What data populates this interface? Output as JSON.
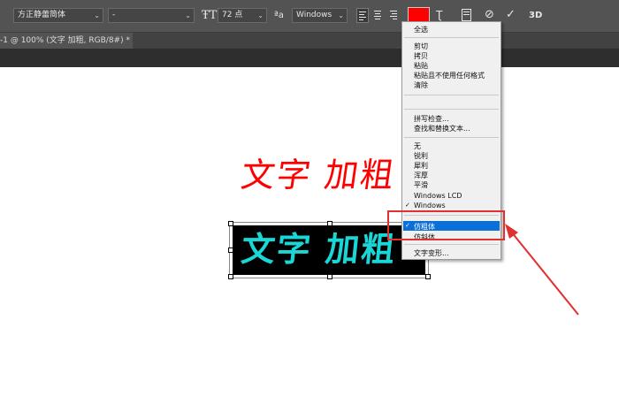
{
  "options_bar": {
    "font_family": "方正静蕾简体",
    "font_style": "-",
    "font_size": "72 点",
    "antialias": "Windows",
    "text_color": "#ff0000",
    "tool_icon": "horizontal-type-tool-icon",
    "align_icons": [
      "align-left-icon",
      "align-center-icon",
      "align-right-icon"
    ],
    "warp_icon": "warp-text-icon",
    "panels_icon": "character-panel-icon",
    "cancel_icon": "cancel-icon",
    "commit_icon": "commit-icon",
    "threed_label": "3D"
  },
  "document_tab": {
    "title": "-1 @ 100% (文字 加粗, RGB/8#) *",
    "close": "×"
  },
  "canvas": {
    "text_top": "文字 加粗",
    "text_top_color": "#ff0000",
    "text_selected": "文字 加粗",
    "text_selected_color": "#1ad7d7"
  },
  "context_menu": {
    "items": [
      "全选",
      "剪切",
      "拷贝",
      "粘贴",
      "粘贴且不使用任何格式",
      "清除",
      "拼写检查...",
      "查找和替换文本...",
      "无",
      "锐利",
      "犀利",
      "浑厚",
      "平滑",
      "Windows LCD",
      "Windows",
      "仿粗体",
      "仿斜体",
      "文字变形..."
    ],
    "checked_items": [
      "Windows",
      "仿粗体"
    ],
    "check_mark": "✓",
    "highlighted": "仿粗体"
  },
  "annotation": {
    "color": "#e03030"
  }
}
